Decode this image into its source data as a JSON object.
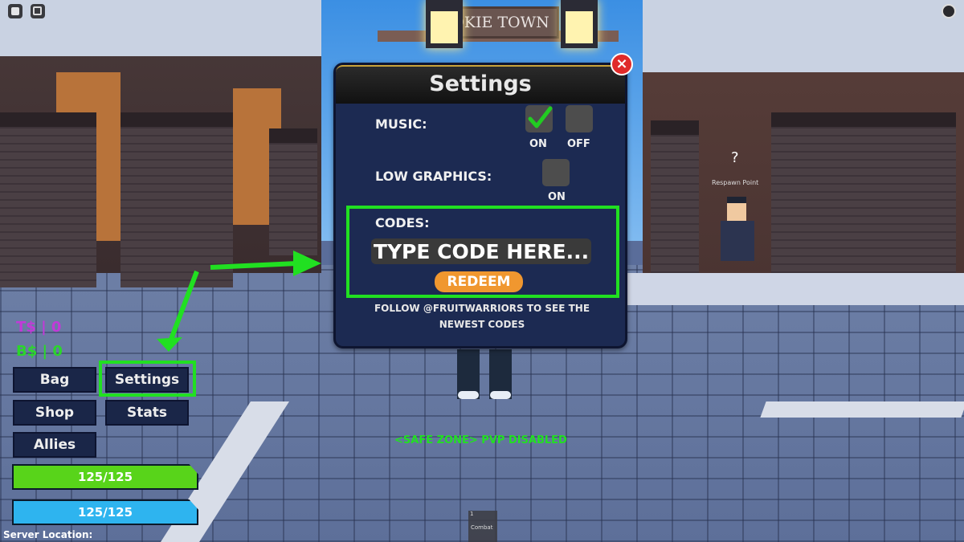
{
  "scene": {
    "town_sign": "OKIE TOWN",
    "npc_marker": "?",
    "npc_label": "Respawn Point"
  },
  "top_bar": {
    "left_icons": [
      "roblox-menu-icon",
      "chat-icon"
    ],
    "right_icon": "more-options-icon"
  },
  "settings_dialog": {
    "title": "Settings",
    "close_label": "×",
    "music": {
      "label": "MUSIC:",
      "on_label": "ON",
      "off_label": "OFF",
      "on_checked": true,
      "off_checked": false
    },
    "low_graphics": {
      "label": "LOW GRAPHICS:",
      "on_label": "ON",
      "on_checked": false
    },
    "codes": {
      "label": "CODES:",
      "input_placeholder": "TYPE CODE HERE...",
      "input_value": "",
      "redeem_label": "REDEEM"
    },
    "follow_text_line1": "FOLLOW @FRUITWARRIORS TO SEE THE",
    "follow_text_line2": "NEWEST CODES"
  },
  "hud": {
    "currency": [
      {
        "label": "T$ | 0",
        "color": "#c23ad8"
      },
      {
        "label": "B$ | 0",
        "color": "#2bd62b"
      }
    ],
    "buttons": {
      "bag": "Bag",
      "settings": "Settings",
      "shop": "Shop",
      "stats": "Stats",
      "allies": "Allies"
    },
    "health_bar": {
      "text": "125/125",
      "current": 125,
      "max": 125,
      "color": "#58d41a"
    },
    "energy_bar": {
      "text": "125/125",
      "current": 125,
      "max": 125,
      "color": "#2eb4ef"
    },
    "server_location_label": "Server Location:"
  },
  "status": {
    "safe_zone": "<SAFE ZONE> PVP DISABLED"
  },
  "hotbar": [
    {
      "slot": "1",
      "name": "Combat"
    }
  ],
  "annotation_color": "#21e021"
}
